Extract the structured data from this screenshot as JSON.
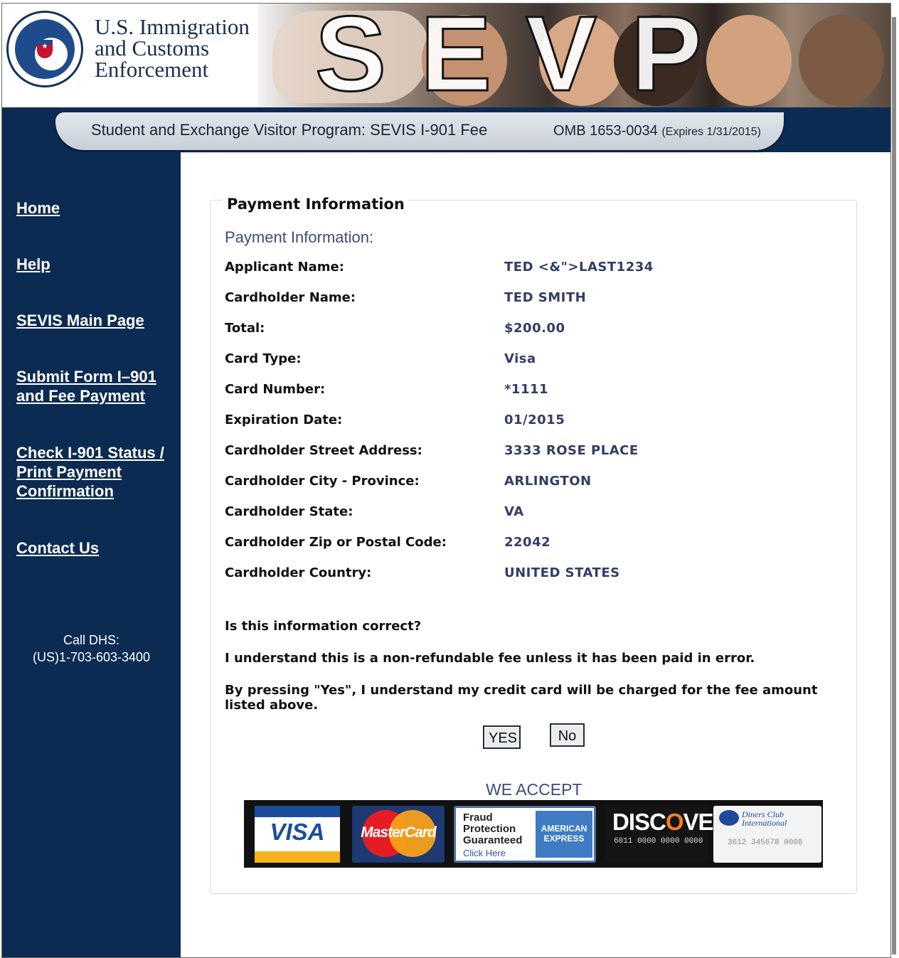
{
  "header": {
    "agency_line1": "U.S. Immigration",
    "agency_line2": "and Customs",
    "agency_line3": "Enforcement",
    "banner_text": "SEVP",
    "seal_icon": "dhs-seal-icon"
  },
  "subtitle": {
    "program": "Student and Exchange Visitor Program: SEVIS I-901 Fee",
    "omb": "OMB 1653-0034",
    "expires": "(Expires 1/31/2015)"
  },
  "sidebar": {
    "items": [
      {
        "label": "Home"
      },
      {
        "label": "Help"
      },
      {
        "label": "SEVIS Main Page"
      },
      {
        "label_line1": "Submit Form I–901",
        "label_line2": "and Fee Payment"
      },
      {
        "label_line1": "Check I-901 Status /",
        "label_line2": "Print Payment",
        "label_line3": "Confirmation"
      },
      {
        "label": "Contact Us"
      }
    ],
    "call_label": "Call DHS:",
    "call_number": "(US)1-703-603-3400"
  },
  "main": {
    "legend": "Payment Information",
    "section_title": "Payment Information:",
    "fields": [
      {
        "label": "Applicant Name:",
        "value": "TED <&\">LAST1234"
      },
      {
        "label": "Cardholder Name:",
        "value": "TED SMITH"
      },
      {
        "label": "Total:",
        "value": "$200.00"
      },
      {
        "label": "Card Type:",
        "value": "Visa"
      },
      {
        "label": "Card Number:",
        "value": "*1111"
      },
      {
        "label": "Expiration Date:",
        "value": "01/2015"
      },
      {
        "label": "Cardholder Street Address:",
        "value": "3333 ROSE PLACE"
      },
      {
        "label": "Cardholder City - Province:",
        "value": "ARLINGTON"
      },
      {
        "label": "Cardholder State:",
        "value": "VA"
      },
      {
        "label": "Cardholder Zip or Postal Code:",
        "value": "22042"
      },
      {
        "label": "Cardholder Country:",
        "value": "UNITED STATES"
      }
    ],
    "question": "Is this information correct?",
    "non_refundable": "I understand this is a non-refundable fee unless it has been paid in error.",
    "consent": "By pressing \"Yes\", I understand my credit card will be charged for the fee amount listed above.",
    "yes_label": "YES",
    "no_label": "No",
    "we_accept": "WE ACCEPT",
    "cards": {
      "visa": "VISA",
      "mastercard": "MasterCard",
      "amex_line1": "Fraud",
      "amex_line2": "Protection",
      "amex_line3": "Guaranteed",
      "amex_click": "Click Here",
      "amex_brand_line1": "AMERICAN",
      "amex_brand_line2": "EXPRESS",
      "discover_pre": "DI",
      "discover_s": "S",
      "discover_c": "C",
      "discover_o": "O",
      "discover_post": "VER",
      "discover_number": "6011 0000 0000 0000",
      "diners_line1": "Diners Club",
      "diners_line2": "International",
      "diners_number": "3612 345678 0008"
    }
  }
}
